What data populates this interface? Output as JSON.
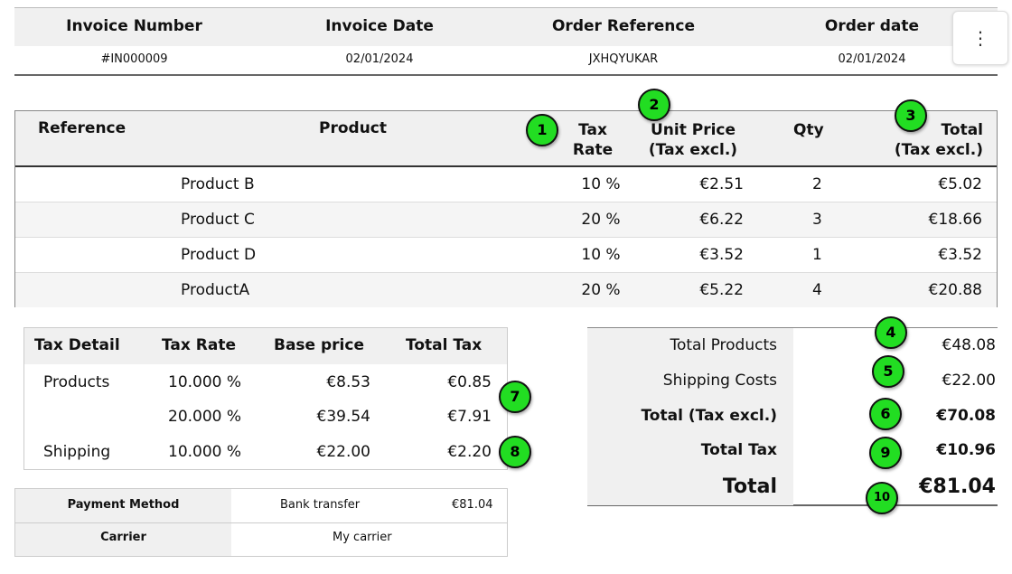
{
  "header": {
    "columns": [
      "Invoice Number",
      "Invoice Date",
      "Order Reference",
      "Order date"
    ],
    "values": [
      "#IN000009",
      "02/01/2024",
      "JXHQYUKAR",
      "02/01/2024"
    ],
    "menu_icon": "⋮"
  },
  "products": {
    "columns": {
      "reference": "Reference",
      "product": "Product",
      "tax_rate_1": "Tax",
      "tax_rate_2": "Rate",
      "unit_price_1": "Unit Price",
      "unit_price_2": "(Tax excl.)",
      "qty": "Qty",
      "total_1": "Total",
      "total_2": "(Tax excl.)"
    },
    "rows": [
      {
        "product": "Product B",
        "tax_rate": "10 %",
        "unit_price": "€2.51",
        "qty": "2",
        "total": "€5.02"
      },
      {
        "product": "Product C",
        "tax_rate": "20 %",
        "unit_price": "€6.22",
        "qty": "3",
        "total": "€18.66"
      },
      {
        "product": "Product D",
        "tax_rate": "10 %",
        "unit_price": "€3.52",
        "qty": "1",
        "total": "€3.52"
      },
      {
        "product": "ProductA",
        "tax_rate": "20 %",
        "unit_price": "€5.22",
        "qty": "4",
        "total": "€20.88"
      }
    ]
  },
  "tax_detail": {
    "columns": [
      "Tax Detail",
      "Tax Rate",
      "Base price",
      "Total Tax"
    ],
    "rows": [
      {
        "detail": "Products",
        "rate": "10.000 %",
        "base": "€8.53",
        "tax": "€0.85"
      },
      {
        "detail": "",
        "rate": "20.000 %",
        "base": "€39.54",
        "tax": "€7.91"
      },
      {
        "detail": "Shipping",
        "rate": "10.000 %",
        "base": "€22.00",
        "tax": "€2.20"
      }
    ]
  },
  "totals": {
    "total_products_label": "Total Products",
    "total_products_value": "€48.08",
    "shipping_label": "Shipping Costs",
    "shipping_value": "€22.00",
    "total_excl_label": "Total (Tax excl.)",
    "total_excl_value": "€70.08",
    "total_tax_label": "Total Tax",
    "total_tax_value": "€10.96",
    "total_label": "Total",
    "total_value": "€81.04"
  },
  "payment": {
    "method_label": "Payment Method",
    "method_value": "Bank transfer",
    "method_amount": "€81.04",
    "carrier_label": "Carrier",
    "carrier_value": "My carrier"
  },
  "badges": [
    "1",
    "2",
    "3",
    "4",
    "5",
    "6",
    "7",
    "8",
    "9",
    "10"
  ],
  "colors": {
    "badge": "#22dd22",
    "header_bg": "#f0f0f0"
  }
}
